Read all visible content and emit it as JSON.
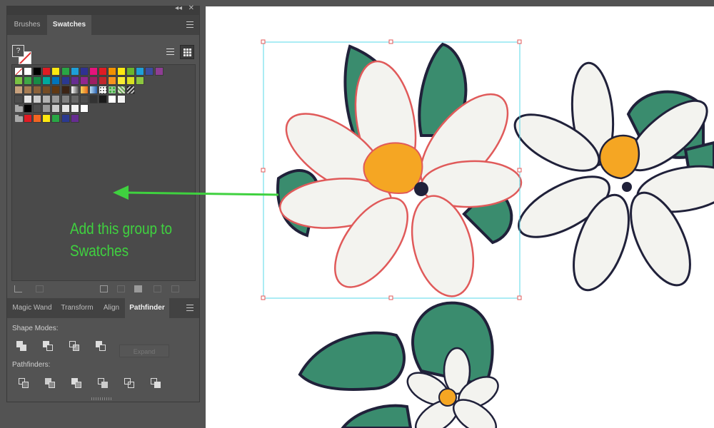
{
  "panel_top": {
    "collapse_icon": "double-chevron-left-icon",
    "close_icon": "close-icon"
  },
  "swatches_panel": {
    "tabs": [
      {
        "label": "Brushes"
      },
      {
        "label": "Swatches",
        "active": true
      }
    ],
    "fill_none_label": "?",
    "rows": [
      [
        "none",
        "#ffffff",
        "#000000",
        "#e01b24",
        "#fde910",
        "#29a745",
        "#1e9fd8",
        "#2f3192",
        "#e5147c",
        "#e01b24",
        "#f29100",
        "#fde910",
        "#6ab42d",
        "#1e9fd8",
        "#3b4ca0",
        "#8f3d94"
      ],
      [
        "#7ac143",
        "#3fa846",
        "#178c45",
        "#00a99d",
        "#0074bc",
        "#2b3990",
        "#662d91",
        "#91278f",
        "#9e1f63",
        "#c1272d",
        "#f7931e",
        "#f9ed32",
        "#d9e021",
        "#8cc63f"
      ],
      [
        "#c7a17d",
        "#a67c52",
        "#8c6239",
        "#754c24",
        "#603813",
        "#3c2415",
        "gradient-white",
        "gradient-orange",
        "gradient-blue",
        "pattern-dots",
        "pattern-green",
        "pattern-grid",
        "pattern-dark"
      ],
      [
        "#4d4d4d",
        "#e6e6e6",
        "#cccccc",
        "#b3b3b3",
        "#999999",
        "#808080",
        "#666666",
        "#4d4d4d",
        "#333333",
        "#1a1a1a",
        "#ffffff",
        "#f2f2f2"
      ],
      [
        "folder",
        "#000000",
        "#4d4d4d",
        "#999999",
        "#cccccc",
        "#e6e6e6",
        "#f2f2f2",
        "#ffffff"
      ],
      [
        "folder",
        "#e01b24",
        "#f26522",
        "#fde910",
        "#29a745",
        "#2b3990",
        "#662d91"
      ]
    ],
    "bottom_tool_icons": [
      "swatch-libraries-icon",
      "show-kinds-icon",
      "swatch-options-icon",
      "color-group-icon",
      "new-folder-icon",
      "new-swatch-icon",
      "delete-icon"
    ]
  },
  "annotation": {
    "line1": "Add this group to",
    "line2": "Swatches",
    "color": "#3fd13f"
  },
  "pathfinder_panel": {
    "tabs": [
      {
        "label": "Magic Wand"
      },
      {
        "label": "Transform"
      },
      {
        "label": "Align"
      },
      {
        "label": "Pathfinder",
        "active": true
      }
    ],
    "shape_modes_label": "Shape Modes:",
    "shape_mode_icons": [
      "unite-icon",
      "minus-front-icon",
      "intersect-icon",
      "exclude-icon"
    ],
    "expand_label": "Expand",
    "pathfinders_label": "Pathfinders:",
    "pathfinder_icons": [
      "divide-icon",
      "trim-icon",
      "merge-icon",
      "crop-icon",
      "outline-icon",
      "minus-back-icon"
    ]
  },
  "canvas": {
    "selection_color": "#57d9e8",
    "leaf_color": "#3a8c6e",
    "petal_color": "#f3f3ef",
    "stamen_color": "#f5a623",
    "outline_color": "#20213a"
  }
}
